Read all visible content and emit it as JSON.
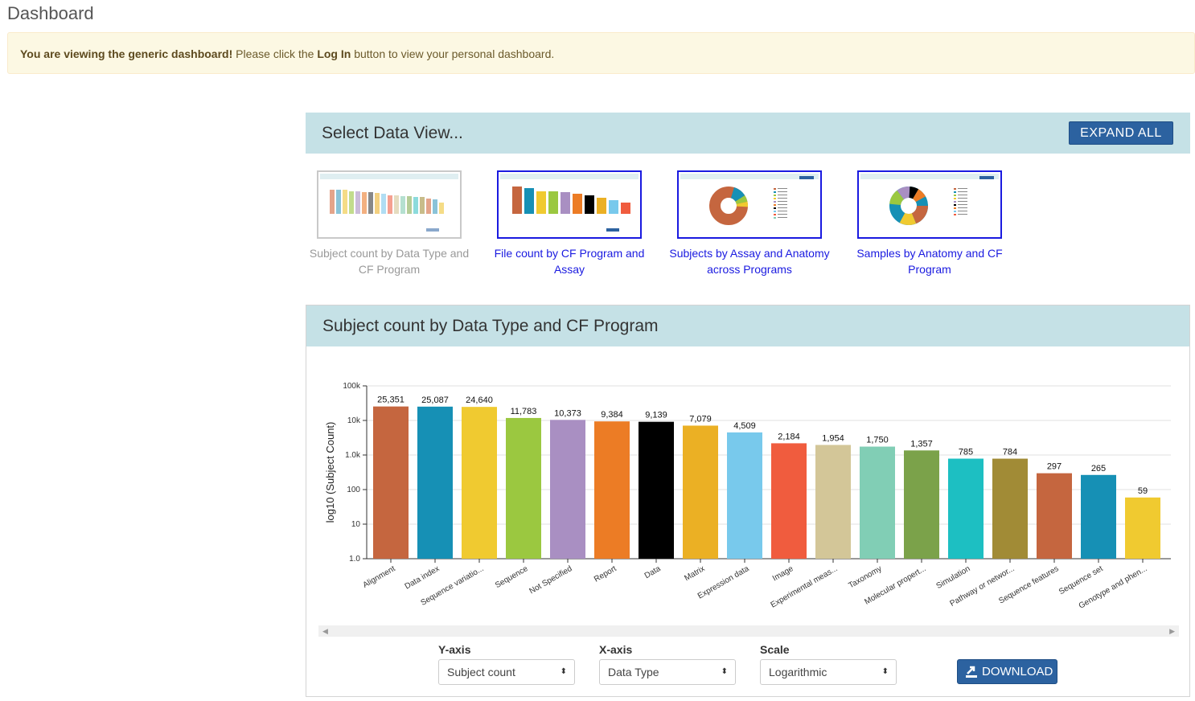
{
  "page": {
    "title": "Dashboard",
    "alert_strong": "You are viewing the generic dashboard!",
    "alert_mid": " Please click the ",
    "alert_login": "Log In",
    "alert_end": " button to view your personal dashboard."
  },
  "data_view": {
    "title": "Select Data View...",
    "expand_label": "EXPAND ALL",
    "options": [
      {
        "label": "Subject count by Data Type and CF Program",
        "active": true
      },
      {
        "label": "File count by CF Program and Assay",
        "active": false
      },
      {
        "label": "Subjects by Assay and Anatomy across Programs",
        "active": false
      },
      {
        "label": "Samples by Anatomy and CF Program",
        "active": false
      }
    ]
  },
  "panel": {
    "title": "Subject count by Data Type and CF Program"
  },
  "controls": {
    "yaxis_label": "Y-axis",
    "yaxis_value": "Subject count",
    "xaxis_label": "X-axis",
    "xaxis_value": "Data Type",
    "scale_label": "Scale",
    "scale_value": "Logarithmic",
    "download_label": "DOWNLOAD"
  },
  "colors": {
    "accent": "#2c62a0",
    "header_bg": "#c5e1e6",
    "alert_bg": "#fcf8e3"
  },
  "chart_data": {
    "type": "bar",
    "ylabel": "log10 (Subject Count)",
    "yscale": "log",
    "ylim": [
      1,
      100000
    ],
    "yticks": [
      {
        "value": 1,
        "label": "1.0"
      },
      {
        "value": 10,
        "label": "10"
      },
      {
        "value": 100,
        "label": "100"
      },
      {
        "value": 1000,
        "label": "1.0k"
      },
      {
        "value": 10000,
        "label": "10k"
      },
      {
        "value": 100000,
        "label": "100k"
      }
    ],
    "grid": true,
    "categories": [
      "Alignment",
      "Data index",
      "Sequence variatio...",
      "Sequence",
      "Not Specified",
      "Report",
      "Data",
      "Matrix",
      "Expression data",
      "Image",
      "Experimental meas...",
      "Taxonomy",
      "Molecular propert...",
      "Simulation",
      "Pathway or networ...",
      "Sequence features",
      "Sequence set",
      "Genotype and phen..."
    ],
    "values": [
      25351,
      25087,
      24640,
      11783,
      10373,
      9384,
      9139,
      7079,
      4509,
      2184,
      1954,
      1750,
      1357,
      785,
      784,
      297,
      265,
      59
    ],
    "value_labels": [
      "25,351",
      "25,087",
      "24,640",
      "11,783",
      "10,373",
      "9,384",
      "9,139",
      "7,079",
      "4,509",
      "2,184",
      "1,954",
      "1,750",
      "1,357",
      "785",
      "784",
      "297",
      "265",
      "59"
    ],
    "colors": [
      "#c5663f",
      "#1690b5",
      "#f0ca30",
      "#9bc840",
      "#a98fc2",
      "#ec7c25",
      "#000000",
      "#ebb024",
      "#78c9ec",
      "#f05c3e",
      "#d3c698",
      "#81ceb5",
      "#7ba24a",
      "#1dbfc2",
      "#a18b36",
      "#c5663f",
      "#1690b5",
      "#f0ca30"
    ]
  }
}
